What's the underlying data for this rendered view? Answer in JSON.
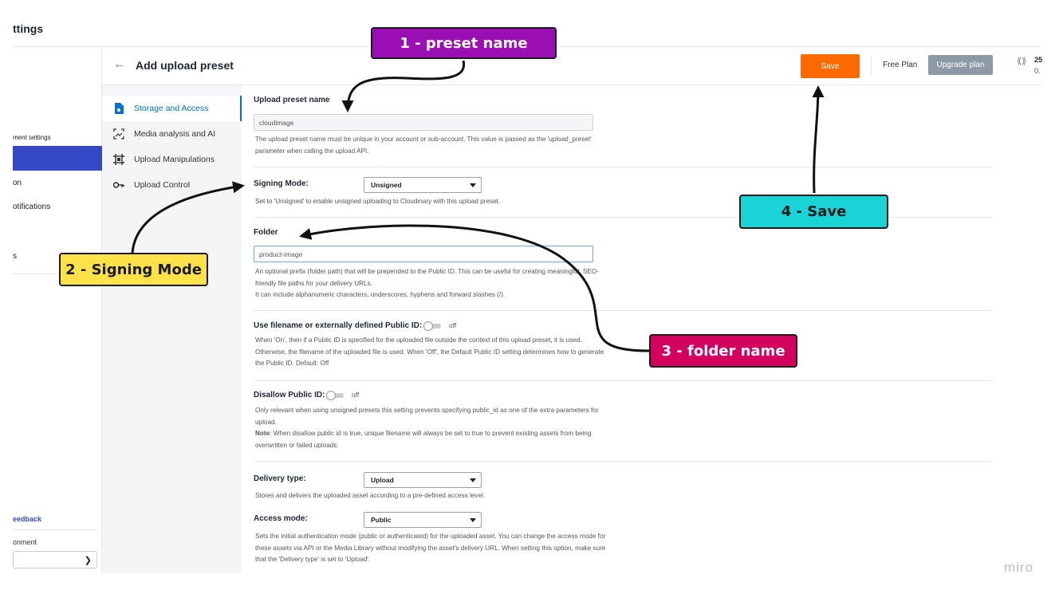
{
  "app": {
    "title": "ttings"
  },
  "left_nav": {
    "items": [
      "ment settings",
      "on",
      "otifications",
      "s"
    ],
    "feedback": "eedback",
    "environment_label": "onment",
    "chevron": "chevron-down-icon"
  },
  "header": {
    "back_icon": "back-arrow-icon",
    "title": "Add upload preset",
    "save": "Save",
    "plan": "Free Plan",
    "upgrade": "Upgrade plan",
    "credits_top": "25",
    "credits_bottom": "0."
  },
  "sections": [
    {
      "label": "Storage and Access",
      "icon": "storage-icon",
      "active": true
    },
    {
      "label": "Media analysis and AI",
      "icon": "media-analysis-icon",
      "active": false
    },
    {
      "label": "Upload Manipulations",
      "icon": "manipulations-icon",
      "active": false
    },
    {
      "label": "Upload Control",
      "icon": "key-icon",
      "active": false
    }
  ],
  "form": {
    "preset_name": {
      "label": "Upload preset name",
      "value": "cloudimage",
      "help": "The upload preset name must be unique in your account or sub-account. This value is passed as the 'upload_preset' parameter when calling the upload API."
    },
    "signing_mode": {
      "label": "Signing Mode:",
      "value": "Unsigned",
      "help": "Set to 'Unsigned' to enable unsigned uploading to Cloudinary with this upload preset."
    },
    "folder": {
      "label": "Folder",
      "value": "product-image",
      "help1": "An optional prefix (folder path) that will be prepended to the Public ID. This can be useful for creating meaningful, SEO-friendly file paths for your delivery URLs.",
      "help2": "It can include alphanumeric characters, underscores, hyphens and forward slashes (/)."
    },
    "use_filename": {
      "label": "Use filename or externally defined Public ID:",
      "state": "off",
      "help": "When 'On', then if a Public ID is specified for the uploaded file outside the context of this upload preset, it is used. Otherwise, the filename of the uploaded file is used. When 'Off', the Default Public ID setting determines how to generate the Public ID. Default: Off"
    },
    "disallow_public_id": {
      "label": "Disallow Public ID:",
      "state": "off",
      "help": "Only relevant when using unsigned presets this setting prevents specifying public_id as one of the extra parameters for upload.",
      "note_label": "Note",
      "note": ": When disallow public id is true, unique filename will always be set to true to prevent existing assets from being overwritten or failed uploads."
    },
    "delivery_type": {
      "label": "Delivery type:",
      "value": "Upload",
      "help": "Stores and delivers the uploaded asset according to a pre-defined access level."
    },
    "access_mode": {
      "label": "Access mode:",
      "value": "Public",
      "help": "Sets the initial authentication mode (public or authenticated) for the uploaded asset. You can change the access mode for these assets via API or the Media Library without modifying the asset's delivery URL. When setting this option, make sure that the 'Delivery type' is set to 'Upload'."
    }
  },
  "annotations": {
    "step1": "1 - preset name",
    "step2": "2 - Signing Mode",
    "step3": "3 - folder name",
    "step4": "4 - Save",
    "watermark": "miro"
  },
  "colors": {
    "save": "#ff6a00",
    "accent": "#0071ce",
    "left_active": "#3448c5",
    "step1": "#9b0eb3",
    "step2": "#ffe14a",
    "step3": "#d4005f",
    "step4": "#1ad3d6"
  }
}
